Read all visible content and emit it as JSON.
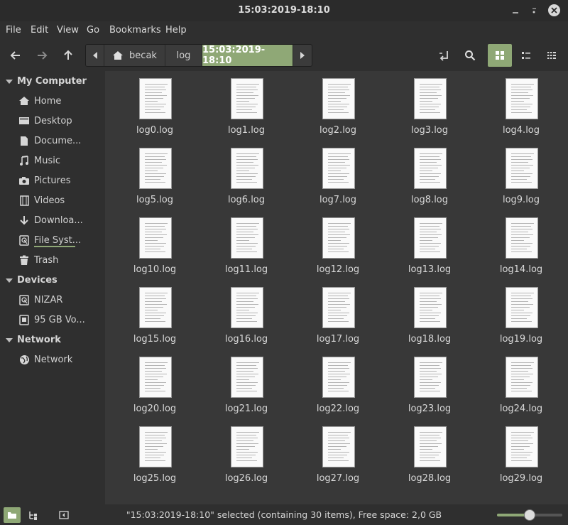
{
  "window": {
    "title": "15:03:2019-18:10"
  },
  "menu": [
    "File",
    "Edit",
    "View",
    "Go",
    "Bookmarks",
    "Help"
  ],
  "path": {
    "home": "becak",
    "middle": "log",
    "current": "15:03:2019-18:10"
  },
  "sidebar": {
    "my_computer": "My Computer",
    "computer_items": [
      "Home",
      "Desktop",
      "Docume...",
      "Music",
      "Pictures",
      "Videos",
      "Downloa...",
      "File Syst...",
      "Trash"
    ],
    "devices": "Devices",
    "device_items": [
      "NIZAR",
      "95 GB Vo..."
    ],
    "network": "Network",
    "network_items": [
      "Network"
    ]
  },
  "files": [
    "log0.log",
    "log1.log",
    "log2.log",
    "log3.log",
    "log4.log",
    "log5.log",
    "log6.log",
    "log7.log",
    "log8.log",
    "log9.log",
    "log10.log",
    "log11.log",
    "log12.log",
    "log13.log",
    "log14.log",
    "log15.log",
    "log16.log",
    "log17.log",
    "log18.log",
    "log19.log",
    "log20.log",
    "log21.log",
    "log22.log",
    "log23.log",
    "log24.log",
    "log25.log",
    "log26.log",
    "log27.log",
    "log28.log",
    "log29.log"
  ],
  "status": {
    "text": "\"15:03:2019-18:10\" selected (containing 30 items), Free space: 2,0 GB",
    "zoom_fraction": 0.5
  },
  "colors": {
    "accent": "#8fa876",
    "background": "#383838"
  }
}
